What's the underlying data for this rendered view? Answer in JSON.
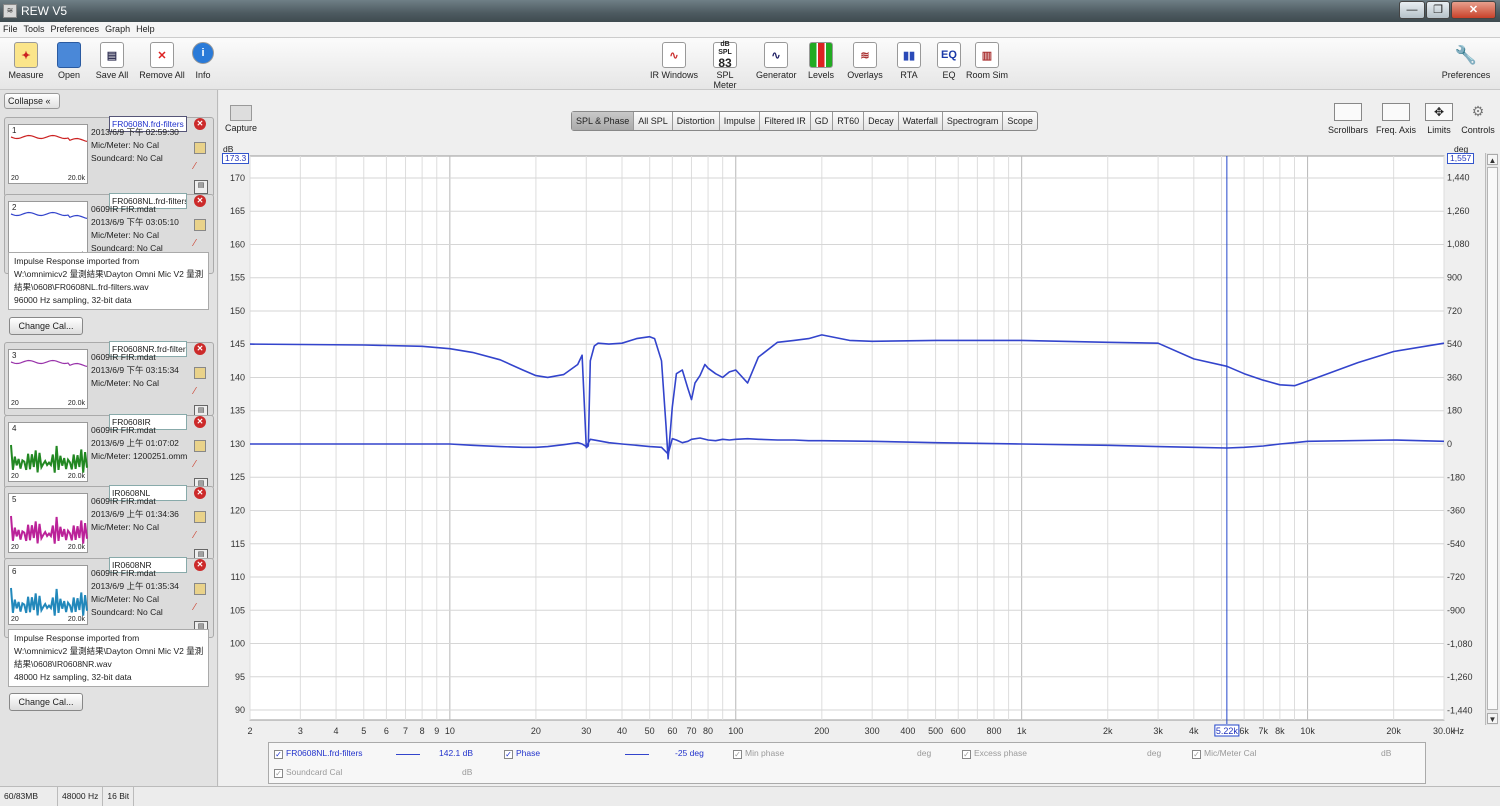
{
  "window": {
    "title": "REW V5"
  },
  "menu": [
    "File",
    "Tools",
    "Preferences",
    "Graph",
    "Help"
  ],
  "toolbar": {
    "left": [
      "Measure",
      "Open",
      "Save All",
      "Remove All",
      "Info"
    ],
    "center": [
      "IR Windows",
      "SPL Meter",
      "Generator",
      "Levels",
      "Overlays",
      "RTA",
      "EQ",
      "Room Sim"
    ],
    "spl_icon_label": "dB SPL",
    "spl_icon_value": "83",
    "eq_icon_text": "EQ",
    "right": "Preferences"
  },
  "left_panel": {
    "collapse": "Collapse",
    "measurements": [
      {
        "index": "1",
        "name": "FR0608N.frd-filters",
        "line1": "2013/6/9 下午 02:59:30",
        "line2": "Mic/Meter: No Cal",
        "line3": "Soundcard: No Cal",
        "color": "#cc2222"
      },
      {
        "index": "2",
        "name": "FR0608NL.frd-filters",
        "line1": "0609IR FIR.mdat",
        "line2": "2013/6/9 下午 03:05:10",
        "line3": "Mic/Meter: No Cal",
        "line4": "Soundcard: No Cal",
        "color": "#3344cc"
      },
      {
        "index": "3",
        "name": "FR0608NR.frd-filters",
        "line1": "0609IR FIR.mdat",
        "line2": "2013/6/9 下午 03:15:34",
        "line3": "Mic/Meter: No Cal",
        "color": "#9933aa"
      },
      {
        "index": "4",
        "name": "FR0608IR",
        "line1": "0609IR FIR.mdat",
        "line2": "2013/6/9 上午 01:07:02",
        "line3": "Mic/Meter: 1200251.omm",
        "color": "#228822"
      },
      {
        "index": "5",
        "name": "IR0608NL",
        "line1": "0609IR FIR.mdat",
        "line2": "2013/6/9 上午 01:34:36",
        "line3": "Mic/Meter: No Cal",
        "color": "#bb2299"
      },
      {
        "index": "6",
        "name": "IR0608NR",
        "line1": "0609IR FIR.mdat",
        "line2": "2013/6/9 上午 01:35:34",
        "line3": "Mic/Meter: No Cal",
        "line4": "Soundcard: No Cal",
        "color": "#2288bb"
      }
    ],
    "thumb_axis_min": "20",
    "thumb_axis_max": "20.0k",
    "notes_a": [
      "Impulse Response imported from",
      "W:\\omnimicv2 量測結果\\Dayton Omni Mic V2 量測",
      "結果\\0608\\FR0608NL.frd-filters.wav",
      "96000 Hz sampling, 32-bit data"
    ],
    "notes_b": [
      "Impulse Response imported from",
      "W:\\omnimicv2 量測結果\\Dayton Omni Mic V2 量測",
      "結果\\0608\\IR0608NR.wav",
      "48000 Hz sampling, 32-bit data"
    ],
    "change_cal": "Change Cal..."
  },
  "graph_tabs": [
    "SPL & Phase",
    "All SPL",
    "Distortion",
    "Impulse",
    "Filtered IR",
    "GD",
    "RT60",
    "Decay",
    "Waterfall",
    "Spectrogram",
    "Scope"
  ],
  "graph_tab_active": "SPL & Phase",
  "capture": "Capture",
  "right_tools": [
    "Scrollbars",
    "Freq. Axis",
    "Limits",
    "Controls"
  ],
  "chart_data": {
    "type": "line",
    "x_scale": "log",
    "xlim": [
      2,
      30000
    ],
    "ylim": [
      88.5,
      173.3
    ],
    "y2lim": [
      -1492,
      1557
    ],
    "ylabel": "dB",
    "y2label": "deg",
    "xunit": "Hz",
    "y_top_value": "173.3",
    "y2_top_value": "1,557",
    "y_ticks": [
      170,
      165,
      160,
      155,
      150,
      145,
      140,
      135,
      130,
      125,
      120,
      115,
      110,
      105,
      100,
      95,
      90
    ],
    "y2_ticks": [
      {
        "v": 1440,
        "t": "1,440"
      },
      {
        "v": 1260,
        "t": "1,260"
      },
      {
        "v": 1080,
        "t": "1,080"
      },
      {
        "v": 900,
        "t": "900"
      },
      {
        "v": 720,
        "t": "720"
      },
      {
        "v": 540,
        "t": "540"
      },
      {
        "v": 360,
        "t": "360"
      },
      {
        "v": 180,
        "t": "180"
      },
      {
        "v": 0,
        "t": "0"
      },
      {
        "v": -180,
        "t": "-180"
      },
      {
        "v": -360,
        "t": "-360"
      },
      {
        "v": -540,
        "t": "-540"
      },
      {
        "v": -720,
        "t": "-720"
      },
      {
        "v": -900,
        "t": "-900"
      },
      {
        "v": -1080,
        "t": "-1,080"
      },
      {
        "v": -1260,
        "t": "-1,260"
      },
      {
        "v": -1440,
        "t": "-1,440"
      }
    ],
    "x_ticks": [
      {
        "v": 2,
        "t": "2"
      },
      {
        "v": 3,
        "t": "3"
      },
      {
        "v": 4,
        "t": "4"
      },
      {
        "v": 5,
        "t": "5"
      },
      {
        "v": 6,
        "t": "6"
      },
      {
        "v": 7,
        "t": "7"
      },
      {
        "v": 8,
        "t": "8"
      },
      {
        "v": 9,
        "t": "9"
      },
      {
        "v": 10,
        "t": "10"
      },
      {
        "v": 20,
        "t": "20"
      },
      {
        "v": 30,
        "t": "30"
      },
      {
        "v": 40,
        "t": "40"
      },
      {
        "v": 50,
        "t": "50"
      },
      {
        "v": 60,
        "t": "60"
      },
      {
        "v": 70,
        "t": "70"
      },
      {
        "v": 80,
        "t": "80"
      },
      {
        "v": 100,
        "t": "100"
      },
      {
        "v": 200,
        "t": "200"
      },
      {
        "v": 300,
        "t": "300"
      },
      {
        "v": 400,
        "t": "400"
      },
      {
        "v": 500,
        "t": "500"
      },
      {
        "v": 600,
        "t": "600"
      },
      {
        "v": 800,
        "t": "800"
      },
      {
        "v": 1000,
        "t": "1k"
      },
      {
        "v": 2000,
        "t": "2k"
      },
      {
        "v": 3000,
        "t": "3k"
      },
      {
        "v": 4000,
        "t": "4k"
      },
      {
        "v": 6000,
        "t": "6k"
      },
      {
        "v": 7000,
        "t": "7k"
      },
      {
        "v": 8000,
        "t": "8k"
      },
      {
        "v": 10000,
        "t": "10k"
      },
      {
        "v": 20000,
        "t": "20k"
      },
      {
        "v": 30000,
        "t": "30.0k"
      }
    ],
    "cursor": {
      "x": 5220,
      "label": "5.22k"
    },
    "grid": true,
    "series": [
      {
        "name": "FR0608NL.frd-filters",
        "axis": "left",
        "color": "#3344cc",
        "x": [
          2,
          5,
          10,
          12,
          15,
          18,
          20,
          22,
          25,
          28,
          29,
          30,
          31,
          33,
          36,
          40,
          45,
          50,
          55,
          58,
          60,
          62,
          65,
          68,
          70,
          75,
          80,
          85,
          90,
          95,
          100,
          110,
          120,
          140,
          160,
          180,
          200,
          300,
          500,
          1000,
          2000,
          3000,
          4000,
          5220,
          6000,
          7000,
          8000,
          9000,
          10000,
          20000,
          30000
        ],
        "y": [
          130,
          130,
          130,
          129.8,
          129.6,
          129.5,
          129.5,
          129.6,
          129.9,
          130.2,
          130,
          129.6,
          130.7,
          130.5,
          130.2,
          130,
          129.8,
          129.6,
          129.5,
          128.5,
          130.8,
          130.6,
          130.2,
          130.4,
          130.7,
          130.9,
          130.6,
          130.5,
          130.7,
          130.6,
          130.7,
          130.8,
          130.7,
          130.6,
          130.6,
          130.5,
          130.5,
          130.4,
          130.2,
          130,
          129.8,
          129.6,
          129.5,
          129.4,
          129.5,
          129.7,
          130,
          130.2,
          130.4,
          130.6,
          130.4
        ]
      },
      {
        "name": "Phase",
        "axis": "right",
        "color": "#3344cc",
        "x": [
          2,
          5,
          8,
          10,
          12,
          15,
          18,
          20,
          22,
          25,
          28,
          29,
          30,
          30.5,
          31,
          32,
          33,
          36,
          40,
          45,
          50,
          52,
          55,
          57,
          58,
          60,
          62,
          65,
          68,
          70,
          72,
          75,
          78,
          80,
          85,
          90,
          95,
          100,
          110,
          120,
          140,
          160,
          180,
          200,
          250,
          300,
          500,
          1000,
          2000,
          3000,
          4000,
          5220,
          6000,
          7000,
          8000,
          9000,
          10000,
          15000,
          20000,
          30000
        ],
        "y": [
          540,
          535,
          528,
          515,
          495,
          455,
          400,
          370,
          360,
          375,
          430,
          480,
          -20,
          -10,
          450,
          530,
          545,
          540,
          545,
          570,
          580,
          570,
          450,
          100,
          -80,
          200,
          380,
          400,
          300,
          240,
          330,
          370,
          430,
          410,
          380,
          360,
          390,
          400,
          330,
          470,
          550,
          560,
          570,
          590,
          560,
          555,
          560,
          560,
          550,
          545,
          460,
          420,
          380,
          345,
          320,
          315,
          340,
          440,
          500,
          545
        ]
      }
    ]
  },
  "legend": {
    "row1": [
      {
        "label": "FR0608NL.frd-filters",
        "value": "142.1 dB",
        "checked": true
      },
      {
        "label": "Phase",
        "value": "-25 deg",
        "checked": true
      },
      {
        "label": "Min phase",
        "value": "deg",
        "checked": false
      },
      {
        "label": "Excess phase",
        "value": "deg",
        "checked": false
      },
      {
        "label": "Mic/Meter Cal",
        "value": "dB",
        "checked": false
      }
    ],
    "row2": [
      {
        "label": "Soundcard Cal",
        "value": "dB",
        "checked": false
      }
    ]
  },
  "status": {
    "memory": "60/83MB",
    "rate": "48000 Hz",
    "bits": "16 Bit"
  }
}
